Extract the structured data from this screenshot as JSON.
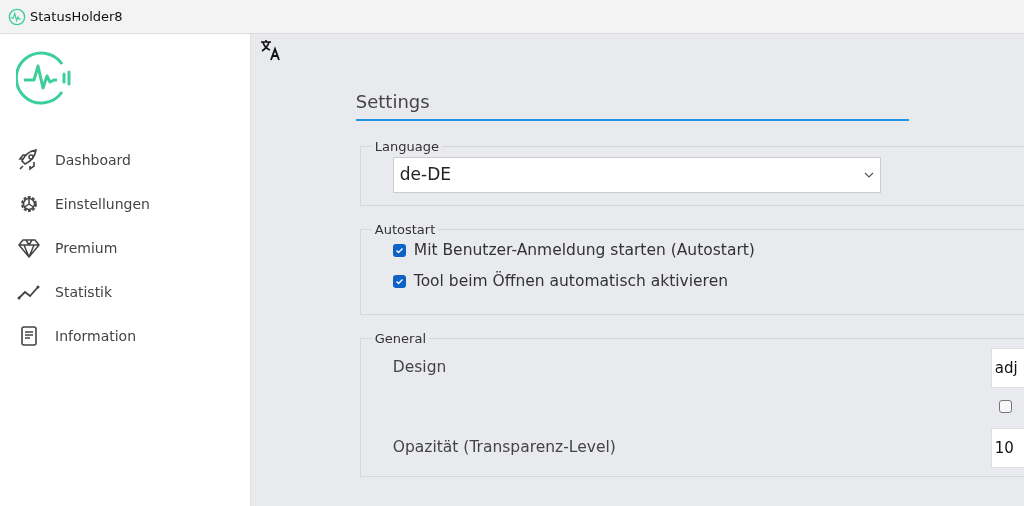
{
  "window": {
    "title": "StatusHolder8"
  },
  "sidebar": {
    "items": [
      {
        "label": "Dashboard",
        "kind": "rocket"
      },
      {
        "label": "Einstellungen",
        "kind": "gear"
      },
      {
        "label": "Premium",
        "kind": "diamond"
      },
      {
        "label": "Statistik",
        "kind": "chart"
      },
      {
        "label": "Information",
        "kind": "doc"
      }
    ]
  },
  "settings": {
    "title": "Settings",
    "language": {
      "legend": "Language",
      "value": "de-DE"
    },
    "autostart": {
      "legend": "Autostart",
      "options": [
        {
          "label": "Mit Benutzer-Anmeldung starten (Autostart)",
          "checked": true
        },
        {
          "label": "Tool beim Öffnen automatisch aktivieren",
          "checked": true
        }
      ]
    },
    "general": {
      "legend": "General",
      "rows": [
        {
          "label": "Design",
          "value": "adj",
          "checkbox": {
            "checked": false
          }
        },
        {
          "label": "Opazität (Transparenz-Level)",
          "value": "10"
        }
      ]
    }
  }
}
